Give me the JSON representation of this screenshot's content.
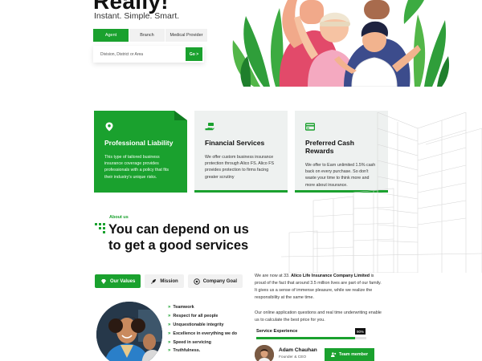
{
  "hero": {
    "title": "Really!",
    "subtitle": "Instant. Simple. Smart."
  },
  "search": {
    "tabs": [
      {
        "label": "Agent",
        "active": true
      },
      {
        "label": "Branch",
        "active": false
      },
      {
        "label": "Medical Provider",
        "active": false
      }
    ],
    "placeholder": "Division, District or Area",
    "go_label": "Go >"
  },
  "cards": [
    {
      "icon": "location-pin-icon",
      "title": "Professional Liability",
      "text": "This type of tailored business insurance coverage provides professionals with a policy that fits their industry's unique risks.",
      "active": true
    },
    {
      "icon": "hand-money-icon",
      "title": "Financial Services",
      "text": "We offer custom business insurance protection through Alico FS. Alico FS provides protection to firms facing greater scrutiny",
      "active": false
    },
    {
      "icon": "credit-card-icon",
      "title": "Preferred Cash Rewards",
      "text": "We offer to Earn unlimited 1.5% cash back on every purchase. So don't waste your time to think more and more about insurance.",
      "active": false
    }
  ],
  "about": {
    "label": "About us",
    "heading": "You can depend on us to get a good services",
    "tabs": [
      {
        "label": "Our Values",
        "icon": "diamond-icon",
        "active": true
      },
      {
        "label": "Mission",
        "icon": "rocket-icon",
        "active": false
      },
      {
        "label": "Company Goal",
        "icon": "target-icon",
        "active": false
      }
    ],
    "values": [
      "Teamwork",
      "Respect for all people",
      "Unquestionable integrity",
      "Excellence in everything we do",
      "Speed in servicing",
      "Truthfulness."
    ],
    "paragraph1_prefix": "We are now at 33. ",
    "paragraph1_company": "Alico Life Insurance Company Limited",
    "paragraph1_suffix": " is proud of the fact that around 3.5 million lives are part of our family. It gives us a sense of immense pleasure, while we realize the responsibility at the same time.",
    "paragraph2": "Our online application questions and real time underwriting enable us to calculate the best price for you.",
    "experience": {
      "label": "Service Experience",
      "value": 90,
      "value_label": "90%"
    },
    "ceo": {
      "name": "Adam Chauhan",
      "role": "Founder & CEO"
    },
    "team_button": "Team member"
  },
  "colors": {
    "brand_green": "#1aa12e",
    "card_bg": "#eef1f0"
  }
}
